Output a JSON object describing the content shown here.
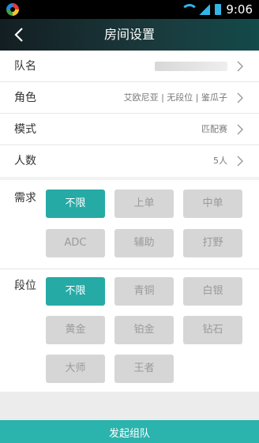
{
  "status_bar": {
    "time": "9:06"
  },
  "header": {
    "title": "房间设置"
  },
  "settings": {
    "team_name_label": "队名",
    "role_label": "角色",
    "role_value": "艾欧尼亚 | 无段位 | 鉴瓜子",
    "mode_label": "模式",
    "mode_value": "匹配赛",
    "count_label": "人数",
    "count_value": "5人"
  },
  "demand": {
    "label": "需求",
    "options": [
      "不限",
      "上单",
      "中单",
      "ADC",
      "辅助",
      "打野"
    ],
    "selected": "不限"
  },
  "rank": {
    "label": "段位",
    "options": [
      "不限",
      "青铜",
      "白银",
      "黄金",
      "铂金",
      "钻石",
      "大师",
      "王者"
    ],
    "selected": "不限"
  },
  "footer": {
    "submit_label": "发起组队"
  },
  "colors": {
    "accent": "#26aaa6",
    "header_dark": "#131e22",
    "chip_inactive": "#d6d6d6"
  }
}
